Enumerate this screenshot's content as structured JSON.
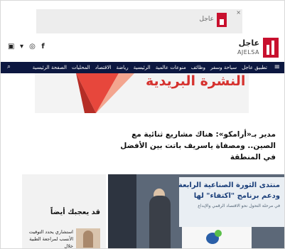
{
  "top_ad": {
    "brand_word": "عاجل",
    "close_label": "×"
  },
  "header": {
    "logo_ar": "عاجل",
    "logo_en": "AJELSA",
    "social": [
      {
        "label": "▣"
      },
      {
        "label": "▾"
      },
      {
        "label": "◎"
      },
      {
        "label": "f"
      }
    ]
  },
  "nav": {
    "menu_icon": "≡",
    "search_icon": "⌕",
    "items": [
      {
        "label": "الصفحة الرئيسية"
      },
      {
        "label": "المحليات"
      },
      {
        "label": "الاقتصاد"
      },
      {
        "label": "رياضة"
      },
      {
        "label": "الرئيسية"
      },
      {
        "label": "منوعات عالمية"
      },
      {
        "label": "وظائف"
      },
      {
        "label": "سياحة وسفر"
      },
      {
        "label": "تطبيق عاجل"
      }
    ]
  },
  "banner": {
    "title": "النشرة البريدية"
  },
  "article": {
    "headline": "مدير بـ«أرامكو»: هناك مشاريع ثنائية مع الصين.. ومصفاة ياسريف باتت بين الأفضل في المنطقة"
  },
  "suggested": {
    "heading": "قد يعجبك أيضاً",
    "item_text": "استشاري يحدد التوقيت الأنسب لمراجعة الطبية خلال"
  },
  "photo": {
    "screen_line1": "منتدى الثورة الصناعية الرابعة",
    "screen_line2": "ودعم برنامج \"اكتفاء\" لها",
    "screen_line3": "في مرحلة التحول نحو الاقتصاد الرقمي والإبداع"
  },
  "colors": {
    "brand_red": "#c8102e",
    "nav_bg": "#0c1740",
    "banner_title": "#d6322f"
  }
}
